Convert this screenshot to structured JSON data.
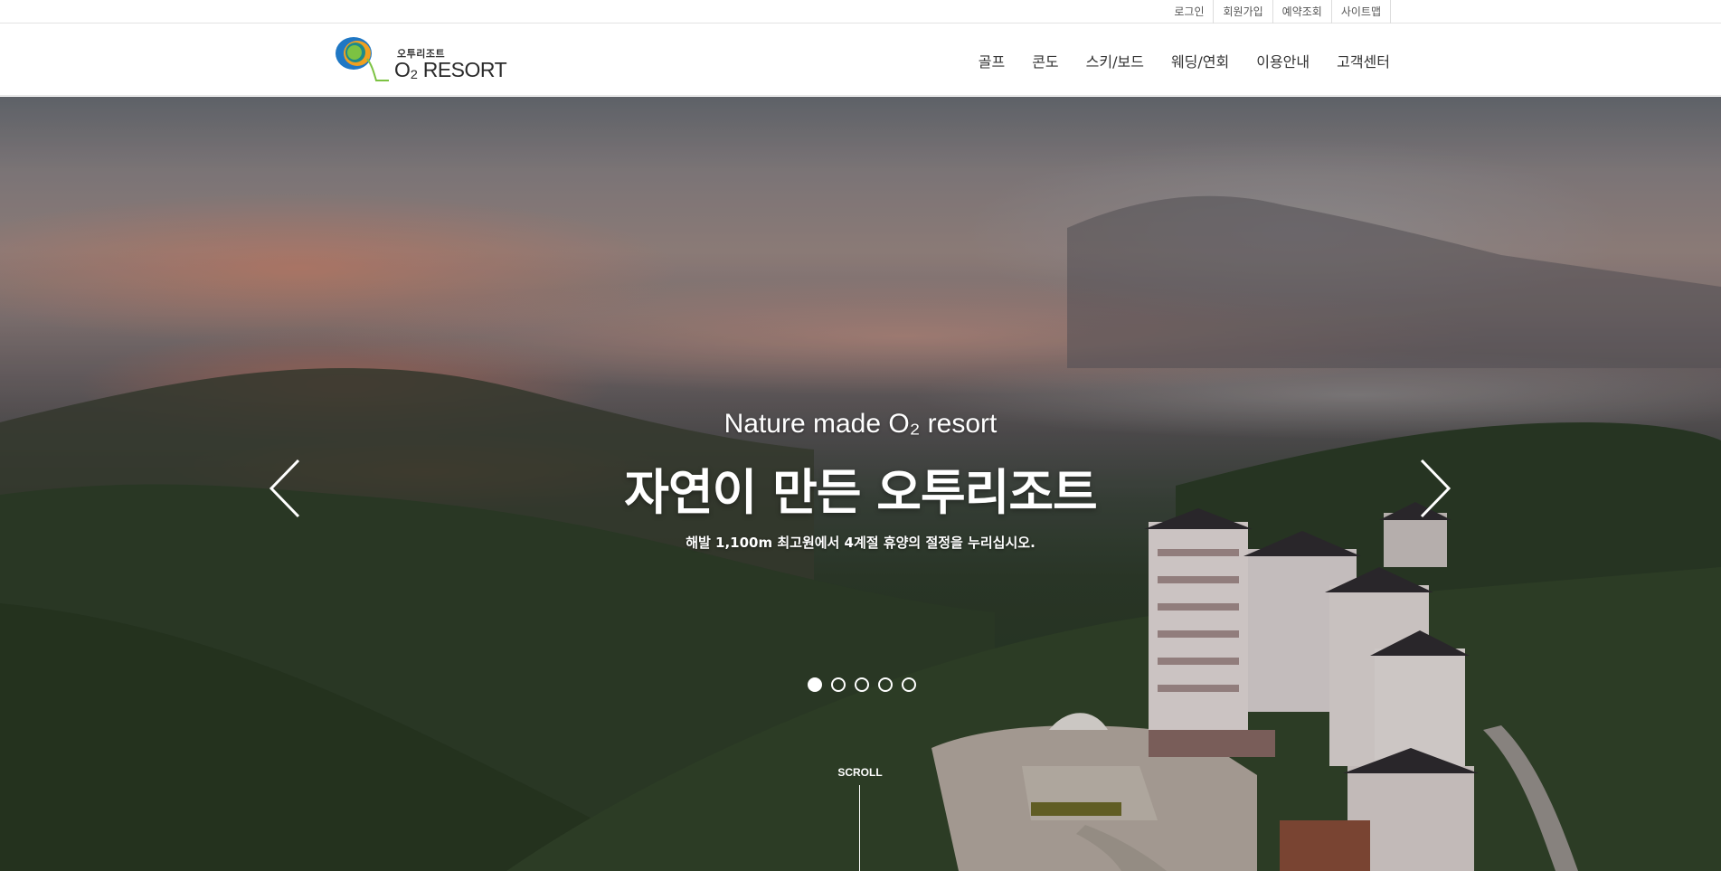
{
  "utility_nav": [
    "로그인",
    "회원가입",
    "예약조회",
    "사이트맵"
  ],
  "logo": {
    "korean": "오투리조트",
    "english": "O₂ RESORT"
  },
  "main_nav": [
    "골프",
    "콘도",
    "스키/보드",
    "웨딩/연회",
    "이용안내",
    "고객센터"
  ],
  "hero": {
    "eyebrow": "Nature made O₂ resort",
    "title": "자연이 만든 오투리조트",
    "subtitle": "해발 1,100m 최고원에서 4계절 휴양의 절정을 누리십시오.",
    "slide_count": 5,
    "active_slide": 1,
    "prev_icon": "chevron-left-icon",
    "next_icon": "chevron-right-icon"
  },
  "scroll_label": "SCROLL",
  "colors": {
    "logo_blue": "#1f77c4",
    "logo_green": "#7cc242",
    "logo_orange": "#f0a020"
  }
}
